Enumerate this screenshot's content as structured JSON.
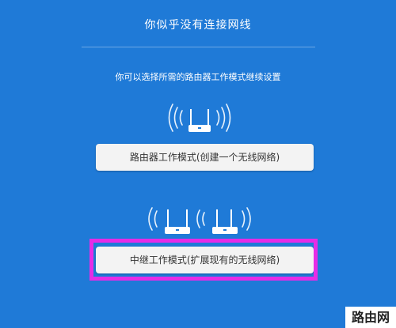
{
  "header": {
    "title": "你似乎没有连接网线",
    "subtitle": "你可以选择所需的路由器工作模式继续设置"
  },
  "modes": {
    "router_label": "路由器工作模式(创建一个无线网络)",
    "repeater_label": "中继工作模式(扩展现有的无线网络)"
  },
  "watermark": {
    "text": "路由网"
  },
  "colors": {
    "background": "#1f7ad7",
    "button": "#f3f3f3",
    "highlight": "#e62ce6"
  },
  "icons": {
    "router": "router-wifi-icon",
    "repeater_pair": "router-repeater-icon"
  }
}
